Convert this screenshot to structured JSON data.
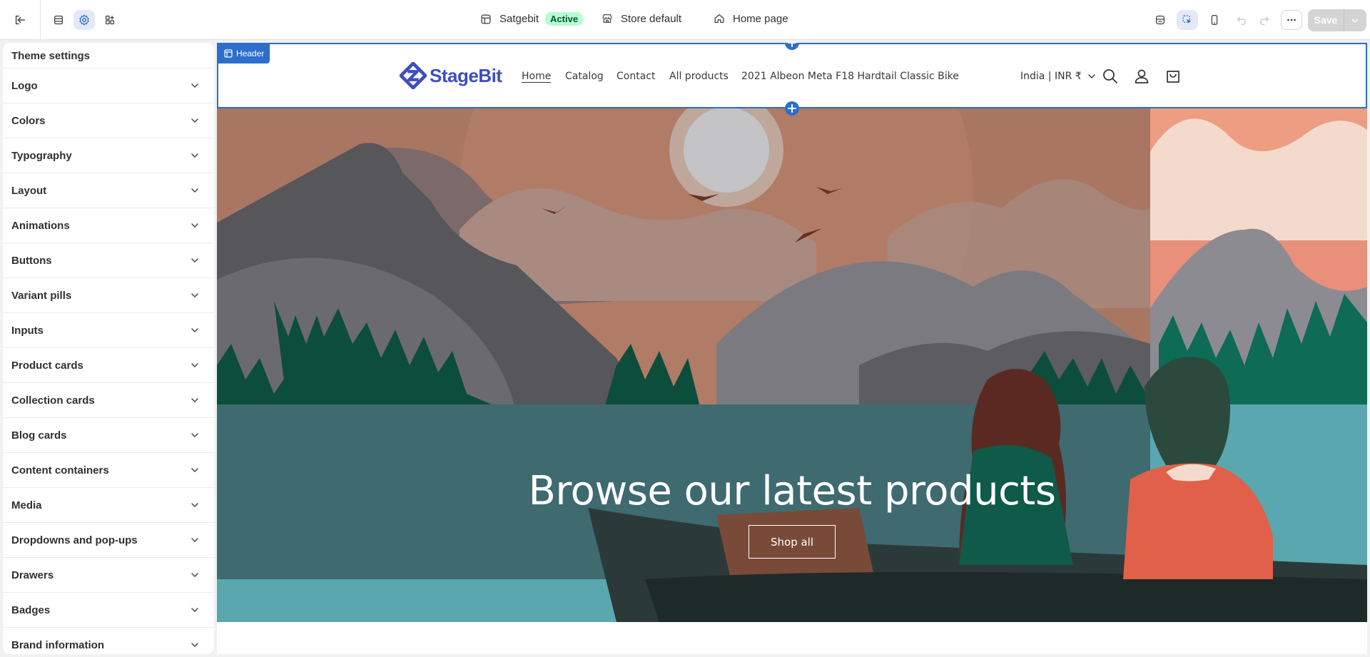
{
  "topbar": {
    "store_name": "Satgebit",
    "status_badge": "Active",
    "store_default_label": "Store default",
    "page_label": "Home page",
    "save_label": "Save"
  },
  "sidebar": {
    "title": "Theme settings",
    "items": [
      {
        "label": "Logo"
      },
      {
        "label": "Colors"
      },
      {
        "label": "Typography"
      },
      {
        "label": "Layout"
      },
      {
        "label": "Animations"
      },
      {
        "label": "Buttons"
      },
      {
        "label": "Variant pills"
      },
      {
        "label": "Inputs"
      },
      {
        "label": "Product cards"
      },
      {
        "label": "Collection cards"
      },
      {
        "label": "Blog cards"
      },
      {
        "label": "Content containers"
      },
      {
        "label": "Media"
      },
      {
        "label": "Dropdowns and pop-ups"
      },
      {
        "label": "Drawers"
      },
      {
        "label": "Badges"
      },
      {
        "label": "Brand information"
      }
    ]
  },
  "preview": {
    "header_tag": "Header",
    "logo_text": "StageBit",
    "nav": [
      {
        "label": "Home"
      },
      {
        "label": "Catalog"
      },
      {
        "label": "Contact"
      },
      {
        "label": "All products"
      },
      {
        "label": "2021 Albeon Meta F18 Hardtail Classic Bike"
      }
    ],
    "country_label": "India | INR ₹",
    "hero_title": "Browse our latest products",
    "hero_button": "Shop all"
  },
  "colors": {
    "accent": "#2c6ecb",
    "brand": "#3d4ec1",
    "badge_bg": "#b4fed2"
  }
}
